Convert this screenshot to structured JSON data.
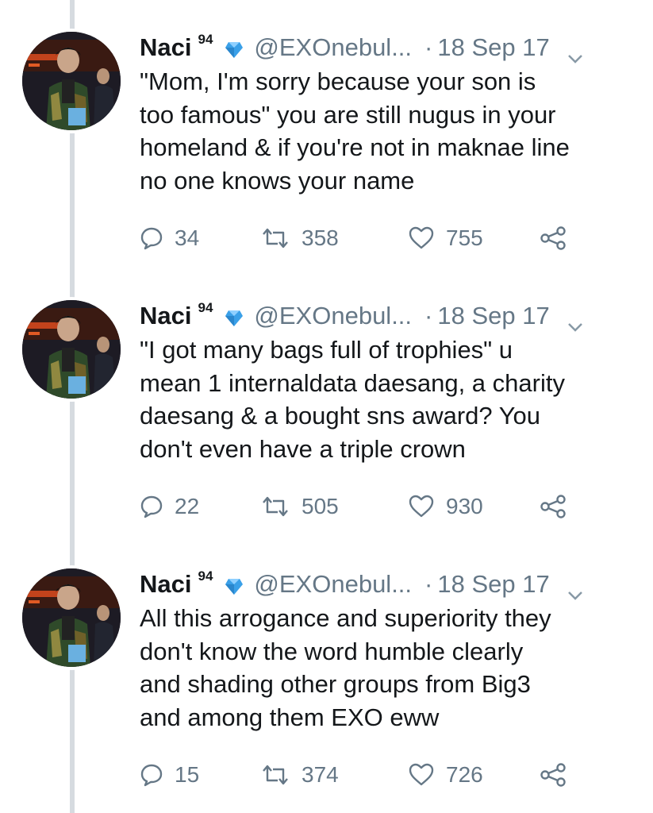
{
  "tweets": [
    {
      "name": "Naci",
      "superscript": "94",
      "handle": "@EXOnebul...",
      "separator": "·",
      "date": "18 Sep 17",
      "text": "\"Mom, I'm sorry because your son is\ntoo famous\" you are still nugus in your\nhomeland & if you're not in maknae line\nno one knows your name",
      "replies": "34",
      "retweets": "358",
      "likes": "755"
    },
    {
      "name": "Naci",
      "superscript": "94",
      "handle": "@EXOnebul...",
      "separator": "·",
      "date": "18 Sep 17",
      "text": "\"I got many bags full of trophies\" u\nmean 1 internaldata daesang, a charity\ndaesang & a bought sns award? You\ndon't even have a triple crown",
      "replies": "22",
      "retweets": "505",
      "likes": "930"
    },
    {
      "name": "Naci",
      "superscript": "94",
      "handle": "@EXOnebul...",
      "separator": "·",
      "date": "18 Sep 17",
      "text": "All this arrogance and superiority they\ndon't know the word humble clearly\nand shading other groups from Big3\nand among them EXO eww",
      "replies": "15",
      "retweets": "374",
      "likes": "726"
    }
  ],
  "icons": {
    "verified": "verified-badge-icon",
    "caret": "chevron-down-icon",
    "reply": "reply-icon",
    "retweet": "retweet-icon",
    "like": "heart-icon",
    "share": "share-icon"
  },
  "colors": {
    "text": "#14171a",
    "secondary": "#657786",
    "verified": "#3aa0e8",
    "thread_line": "#d6dbe0"
  }
}
